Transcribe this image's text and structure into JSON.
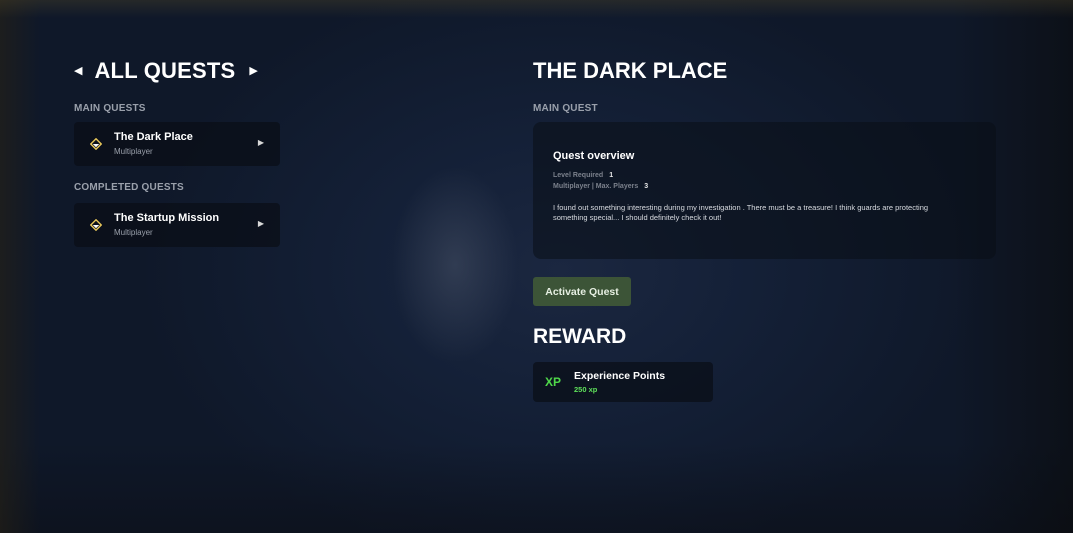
{
  "header": {
    "title": "ALL QUESTS",
    "prev_icon": "caret-left-icon",
    "next_icon": "caret-right-icon"
  },
  "quest_list": {
    "main_label": "MAIN QUESTS",
    "completed_label": "COMPLETED QUESTS",
    "main": [
      {
        "name": "The Dark Place",
        "mode": "Multiplayer",
        "icon": "diamond-quest-icon"
      }
    ],
    "completed": [
      {
        "name": "The Startup Mission",
        "mode": "Multiplayer",
        "icon": "diamond-quest-icon"
      }
    ]
  },
  "detail": {
    "title": "THE DARK PLACE",
    "type_label": "MAIN QUEST",
    "overview_title": "Quest overview",
    "level_label": "Level Required",
    "level_value": "1",
    "players_label": "Multiplayer | Max. Players",
    "players_value": "3",
    "description": "I found out something interesting during my investigation . There must be a treasure! I think guards are protecting something special... I should definitely check it out!",
    "activate_label": "Activate Quest"
  },
  "reward": {
    "title": "REWARD",
    "icon_text": "XP",
    "name": "Experience Points",
    "value": "250 xp"
  },
  "colors": {
    "accent_green": "#4fd84a",
    "button_green": "#3c5437",
    "quest_icon_gold": "#e8c75a"
  }
}
